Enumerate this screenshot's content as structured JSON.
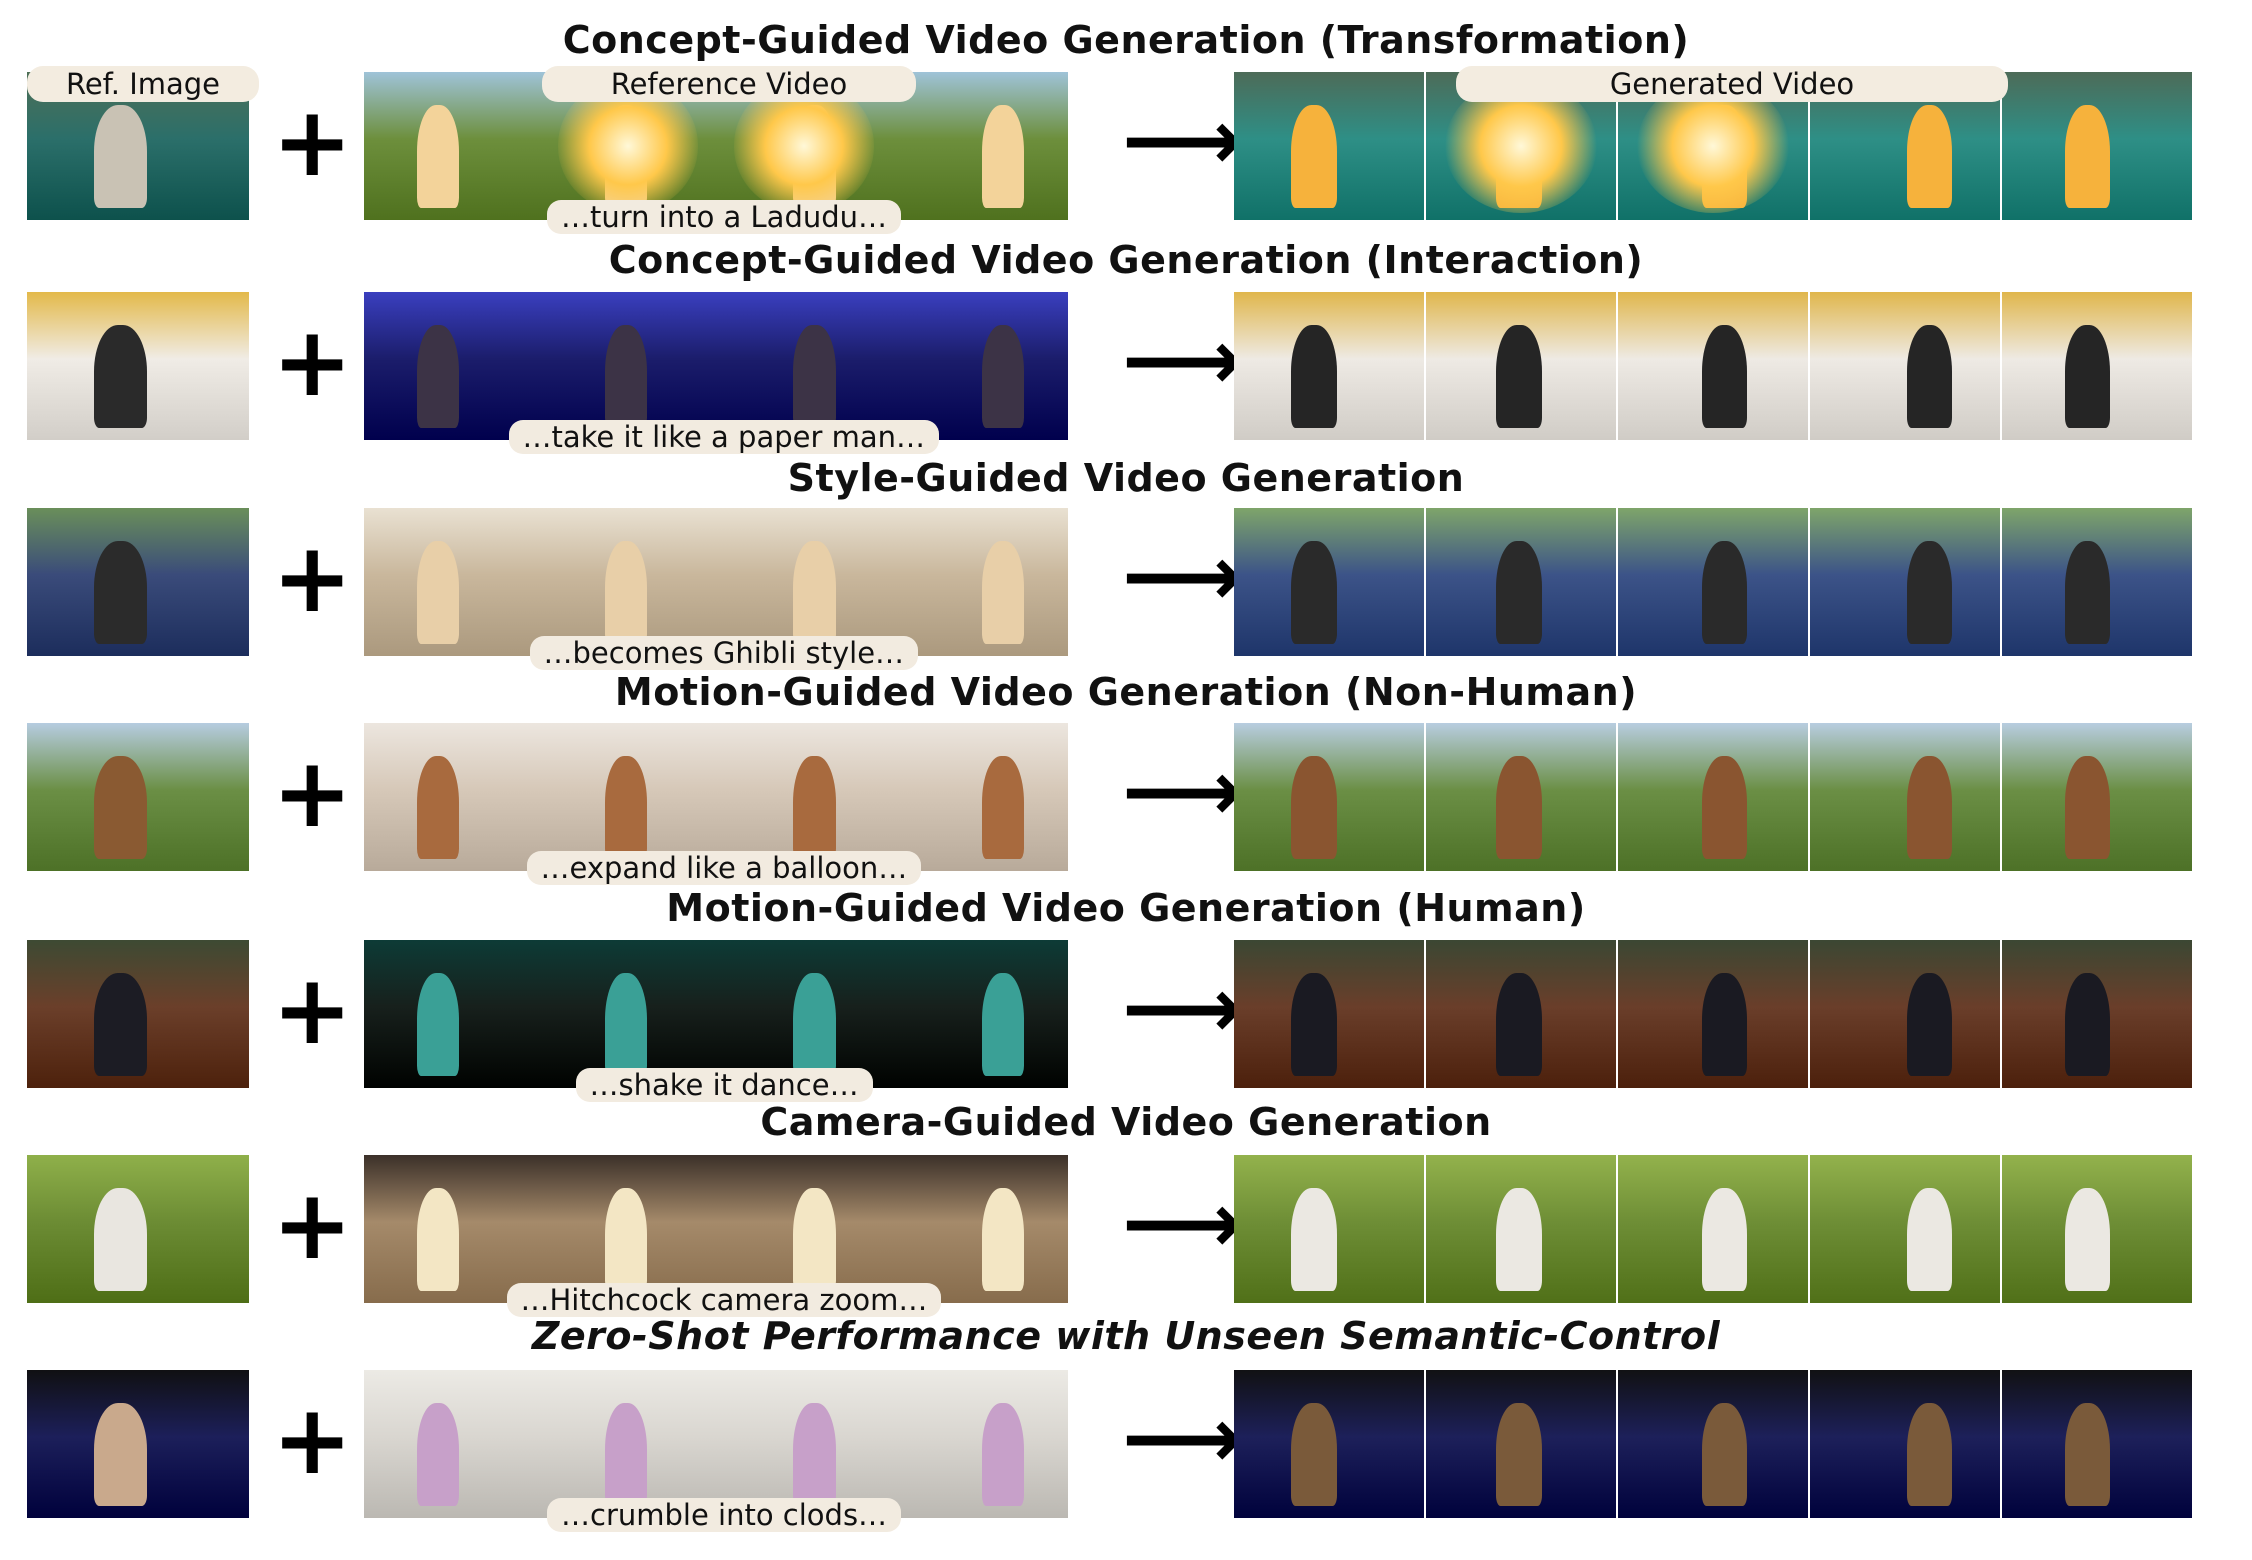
{
  "header_labels": {
    "ref_image": "Ref. Image",
    "reference_video": "Reference Video",
    "generated_video": "Generated Video"
  },
  "rows": [
    {
      "title": "Concept-Guided Video Generation (Transformation)",
      "caption": "…turn into a Ladudu…",
      "palette": {
        "ref": [
          "#4f6f56",
          "#2b6f6a",
          "#c9c2b4"
        ],
        "video": [
          "#9fc3d8",
          "#6d8f3c",
          "#f3d39a"
        ],
        "gen": [
          "#4d6b58",
          "#2e8f86",
          "#f6b23c"
        ]
      },
      "glow": true
    },
    {
      "title": "Concept-Guided Video Generation (Interaction)",
      "caption": "…take it like a paper man…",
      "palette": {
        "ref": [
          "#e3b94a",
          "#f0ece6",
          "#2a2a2a"
        ],
        "video": [
          "#3a3fbf",
          "#1b1d6b",
          "#3c3346"
        ],
        "gen": [
          "#e0b64c",
          "#eeeae4",
          "#252525"
        ]
      },
      "glow": false
    },
    {
      "title": "Style-Guided Video Generation",
      "caption": "…becomes Ghibli style…",
      "palette": {
        "ref": [
          "#6a8f5a",
          "#3a4b7a",
          "#2b2b2b"
        ],
        "video": [
          "#e9e1d2",
          "#c9b79c",
          "#e8cfa8"
        ],
        "gen": [
          "#7fa56a",
          "#3c5388",
          "#2a2a2a"
        ]
      },
      "glow": false
    },
    {
      "title": "Motion-Guided Video Generation (Non-Human)",
      "caption": "…expand like a balloon…",
      "palette": {
        "ref": [
          "#b6cce0",
          "#6b8f45",
          "#8a5a32"
        ],
        "video": [
          "#ece6df",
          "#d6c8b8",
          "#a86a3e"
        ],
        "gen": [
          "#b8cde0",
          "#6b8f45",
          "#8a5530"
        ]
      },
      "glow": false
    },
    {
      "title": "Motion-Guided Video Generation (Human)",
      "caption": "…shake it dance…",
      "palette": {
        "ref": [
          "#3d4a33",
          "#6b3f2a",
          "#1c1c24"
        ],
        "video": [
          "#0d3b36",
          "#17201c",
          "#3aa096"
        ],
        "gen": [
          "#3b4733",
          "#6a3e2a",
          "#1a1a22"
        ]
      },
      "glow": false
    },
    {
      "title": "Camera-Guided Video Generation",
      "caption": "…Hitchcock camera zoom…",
      "palette": {
        "ref": [
          "#8fb04a",
          "#6c8c34",
          "#e9e6e0"
        ],
        "video": [
          "#3b3029",
          "#a58a6a",
          "#f3e6c4"
        ],
        "gen": [
          "#93b24c",
          "#6e8e36",
          "#ebe8e2"
        ]
      },
      "glow": false
    },
    {
      "title": "Zero-Shot Performance with Unseen Semantic-Control",
      "caption": "…crumble into clods…",
      "palette": {
        "ref": [
          "#101012",
          "#1c1f5a",
          "#c9a98c"
        ],
        "video": [
          "#eceae5",
          "#d9d6d0",
          "#c7a0c9"
        ],
        "gen": [
          "#111113",
          "#1d205a",
          "#7a5a3a"
        ]
      },
      "glow": false,
      "italic": true
    }
  ]
}
